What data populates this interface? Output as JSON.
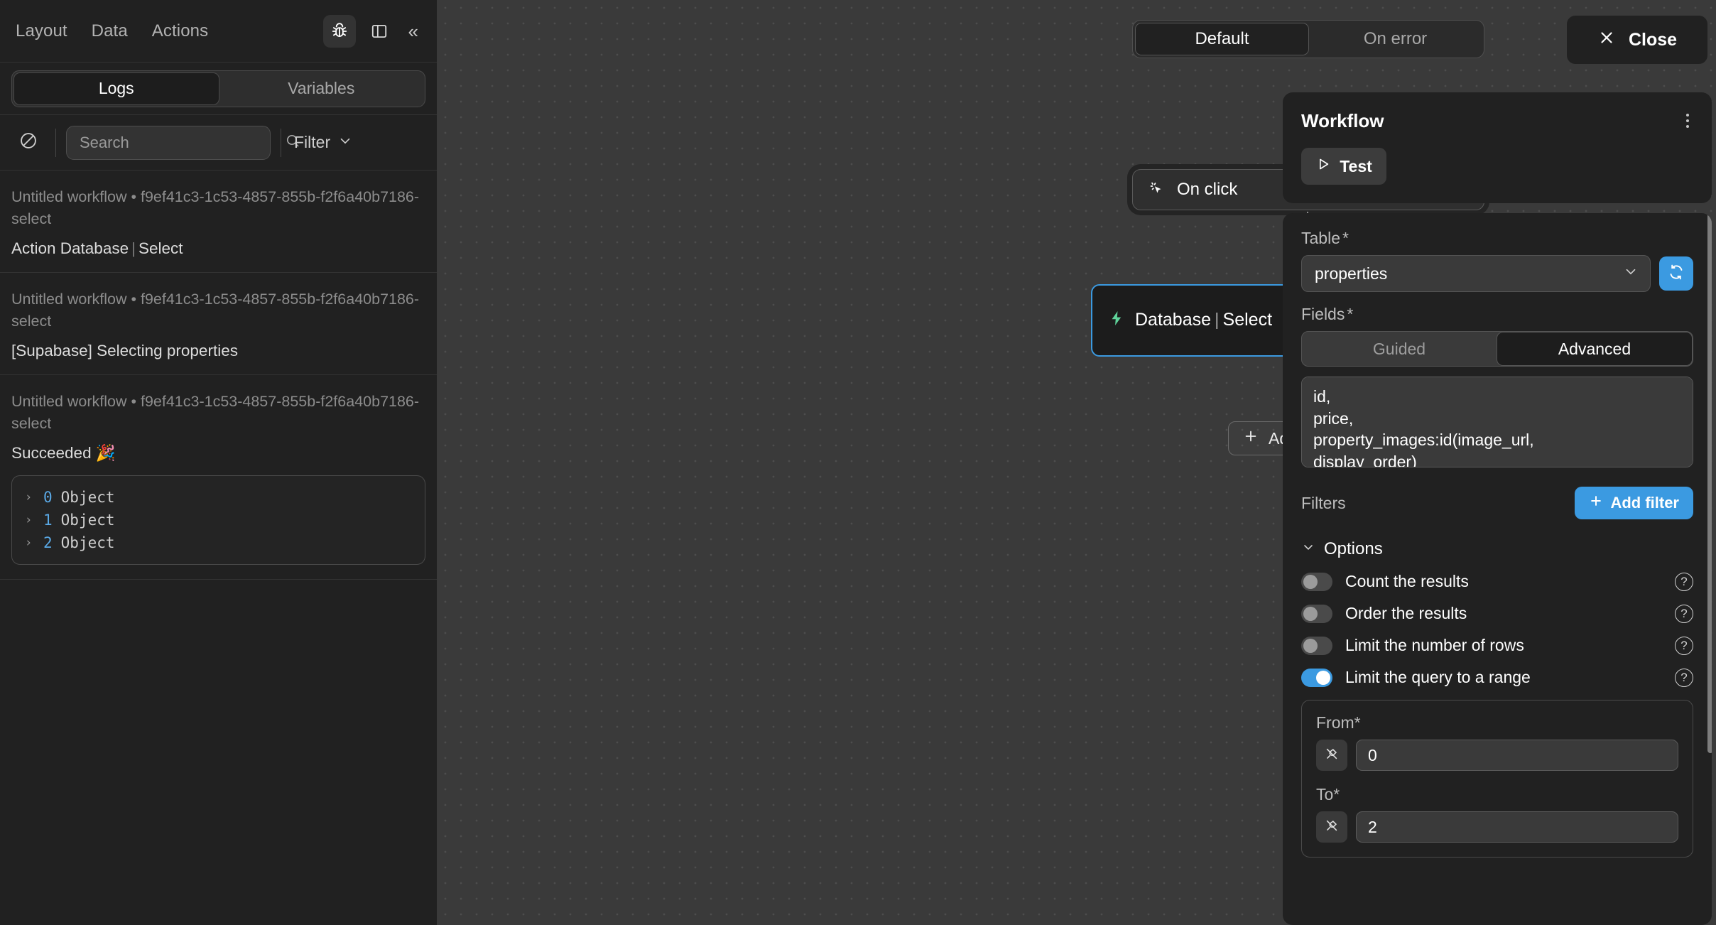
{
  "left_panel": {
    "menu": [
      {
        "label": "Layout",
        "name": "menu-layout"
      },
      {
        "label": "Data",
        "name": "menu-data"
      },
      {
        "label": "Actions",
        "name": "menu-actions"
      }
    ],
    "tools": {
      "debug_icon": "bug-icon",
      "panel_icon": "panel-layout-icon",
      "collapse_label": "«"
    },
    "tabs": [
      {
        "label": "Logs",
        "selected": true
      },
      {
        "label": "Variables",
        "selected": false
      }
    ],
    "search": {
      "placeholder": "Search",
      "value": "",
      "clear_icon": "no-entry-icon",
      "search_icon": "search-icon"
    },
    "filter": {
      "label": "Filter",
      "icon": "chevron-down-icon"
    },
    "logs": [
      {
        "meta": "Untitled workflow • f9ef41c3-1c53-4857-855b-f2f6a40b7186-select",
        "title_prefix": "Action Database",
        "title_suffix": "Select",
        "has_json": false
      },
      {
        "meta": "Untitled workflow • f9ef41c3-1c53-4857-855b-f2f6a40b7186-select",
        "title_plain": "[Supabase] Selecting properties",
        "has_json": false
      },
      {
        "meta": "Untitled workflow • f9ef41c3-1c53-4857-855b-f2f6a40b7186-select",
        "title_plain": "Succeeded 🎉",
        "has_json": true,
        "json_rows": [
          {
            "caret": "›",
            "key": "0",
            "type": "Object"
          },
          {
            "caret": "›",
            "key": "1",
            "type": "Object"
          },
          {
            "caret": "›",
            "key": "2",
            "type": "Object"
          }
        ]
      }
    ]
  },
  "canvas": {
    "mode_tabs": [
      {
        "label": "Default",
        "selected": true
      },
      {
        "label": "On error",
        "selected": false
      }
    ],
    "trigger_node": {
      "label": "On click",
      "icon": "cursor-click-icon",
      "caret": "chevron-down-icon"
    },
    "plus_node_label": "+",
    "action_node": {
      "icon": "lightning-bolt-icon",
      "title_prefix": "Database",
      "title_suffix": "Select",
      "test_label": "Test",
      "test_icon": "play-icon",
      "menu_icon": "kebab-menu-icon"
    },
    "add_action_label": "Add an action",
    "add_action_icon": "plus-icon"
  },
  "right_panel": {
    "close": {
      "label": "Close",
      "icon": "close-icon"
    },
    "workflow": {
      "title": "Workflow",
      "menu_icon": "kebab-menu-icon",
      "test_label": "Test",
      "test_icon": "play-icon"
    },
    "table": {
      "label": "Table",
      "required": "*",
      "value": "properties",
      "caret": "chevron-down-icon",
      "refresh_icon": "refresh-icon"
    },
    "fields": {
      "label": "Fields",
      "required": "*",
      "modes": [
        {
          "label": "Guided",
          "selected": false
        },
        {
          "label": "Advanced",
          "selected": true
        }
      ],
      "value": "id,\nprice,\nproperty_images:id(image_url,\ndisplay_order)"
    },
    "filters": {
      "label": "Filters",
      "add_label": "Add filter",
      "add_icon": "plus-icon"
    },
    "options": {
      "label": "Options",
      "caret": "chevron-down-icon",
      "items": [
        {
          "label": "Count the results",
          "on": false,
          "help": "?"
        },
        {
          "label": "Order the results",
          "on": false,
          "help": "?"
        },
        {
          "label": "Limit the number of rows",
          "on": false,
          "help": "?"
        },
        {
          "label": "Limit the query to a range",
          "on": true,
          "help": "?"
        }
      ]
    },
    "range": {
      "from_label": "From",
      "from_required": "*",
      "from_value": "0",
      "to_label": "To",
      "to_required": "*",
      "to_value": "2",
      "plug_icon": "plug-icon"
    }
  },
  "colors": {
    "accent": "#3b9ae1",
    "node_selected_border": "#3b9ae1",
    "bolt_green": "#5fd39a",
    "canvas_bg": "#3a3a3a",
    "panel_bg": "#212121"
  }
}
